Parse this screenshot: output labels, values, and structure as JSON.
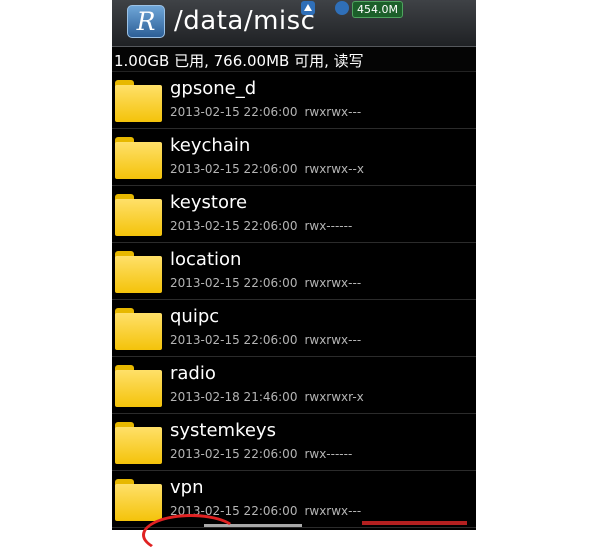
{
  "header": {
    "app_icon_letter": "R",
    "path": "/data/misc",
    "sd_badge": "454.0M"
  },
  "storage_info": "1.00GB 已用, 766.00MB 可用, 读写",
  "files": [
    {
      "name": "gpsone_d",
      "date": "2013-02-15 22:06:00",
      "perm": "rwxrwx---"
    },
    {
      "name": "keychain",
      "date": "2013-02-15 22:06:00",
      "perm": "rwxrwx--x"
    },
    {
      "name": "keystore",
      "date": "2013-02-15 22:06:00",
      "perm": "rwx------"
    },
    {
      "name": "location",
      "date": "2013-02-15 22:06:00",
      "perm": "rwxrwx---"
    },
    {
      "name": "quipc",
      "date": "2013-02-15 22:06:00",
      "perm": "rwxrwx---"
    },
    {
      "name": "radio",
      "date": "2013-02-18 21:46:00",
      "perm": "rwxrwxr-x"
    },
    {
      "name": "systemkeys",
      "date": "2013-02-15 22:06:00",
      "perm": "rwx------"
    },
    {
      "name": "vpn",
      "date": "2013-02-15 22:06:00",
      "perm": "rwxrwx---"
    }
  ],
  "colors": {
    "folder": "#f4c30a",
    "background": "#000000",
    "annotation": "#e02222"
  }
}
